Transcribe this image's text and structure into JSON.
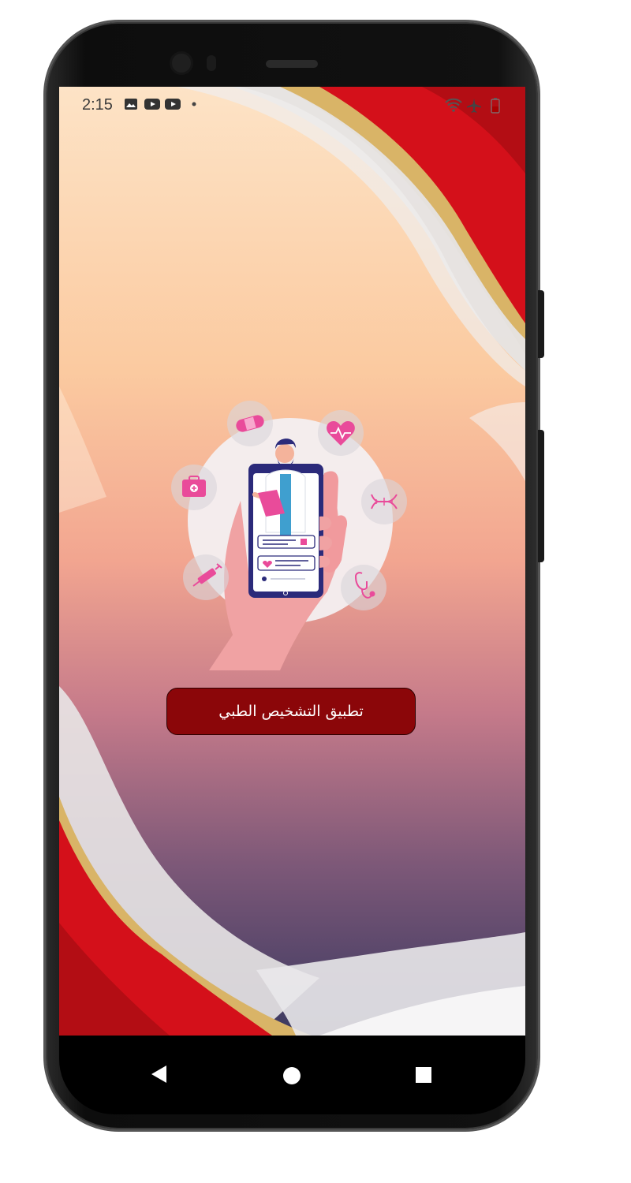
{
  "status_bar": {
    "time": "2:15",
    "left_icons": [
      "image-icon",
      "youtube-icon",
      "youtube-icon",
      "dot-icon"
    ],
    "right_icons": [
      "wifi-icon",
      "airplane-icon",
      "battery-icon"
    ]
  },
  "splash": {
    "title_button": "تطبيق التشخيص الطبي",
    "illustration": "doctor-on-phone-illustration",
    "orbit_icons": [
      "bandage-icon",
      "heart-pulse-icon",
      "first-aid-kit-icon",
      "dna-icon",
      "syringe-icon",
      "stethoscope-icon"
    ]
  },
  "navigation_bar": {
    "buttons": [
      "back-icon",
      "home-icon",
      "recents-icon"
    ]
  },
  "colors": {
    "title_button_bg": "#8b0609",
    "wave_red": "#d4101a",
    "wave_gold": "#d9b467",
    "accent_pink": "#e94b9a",
    "phone_frame": "#111111"
  }
}
